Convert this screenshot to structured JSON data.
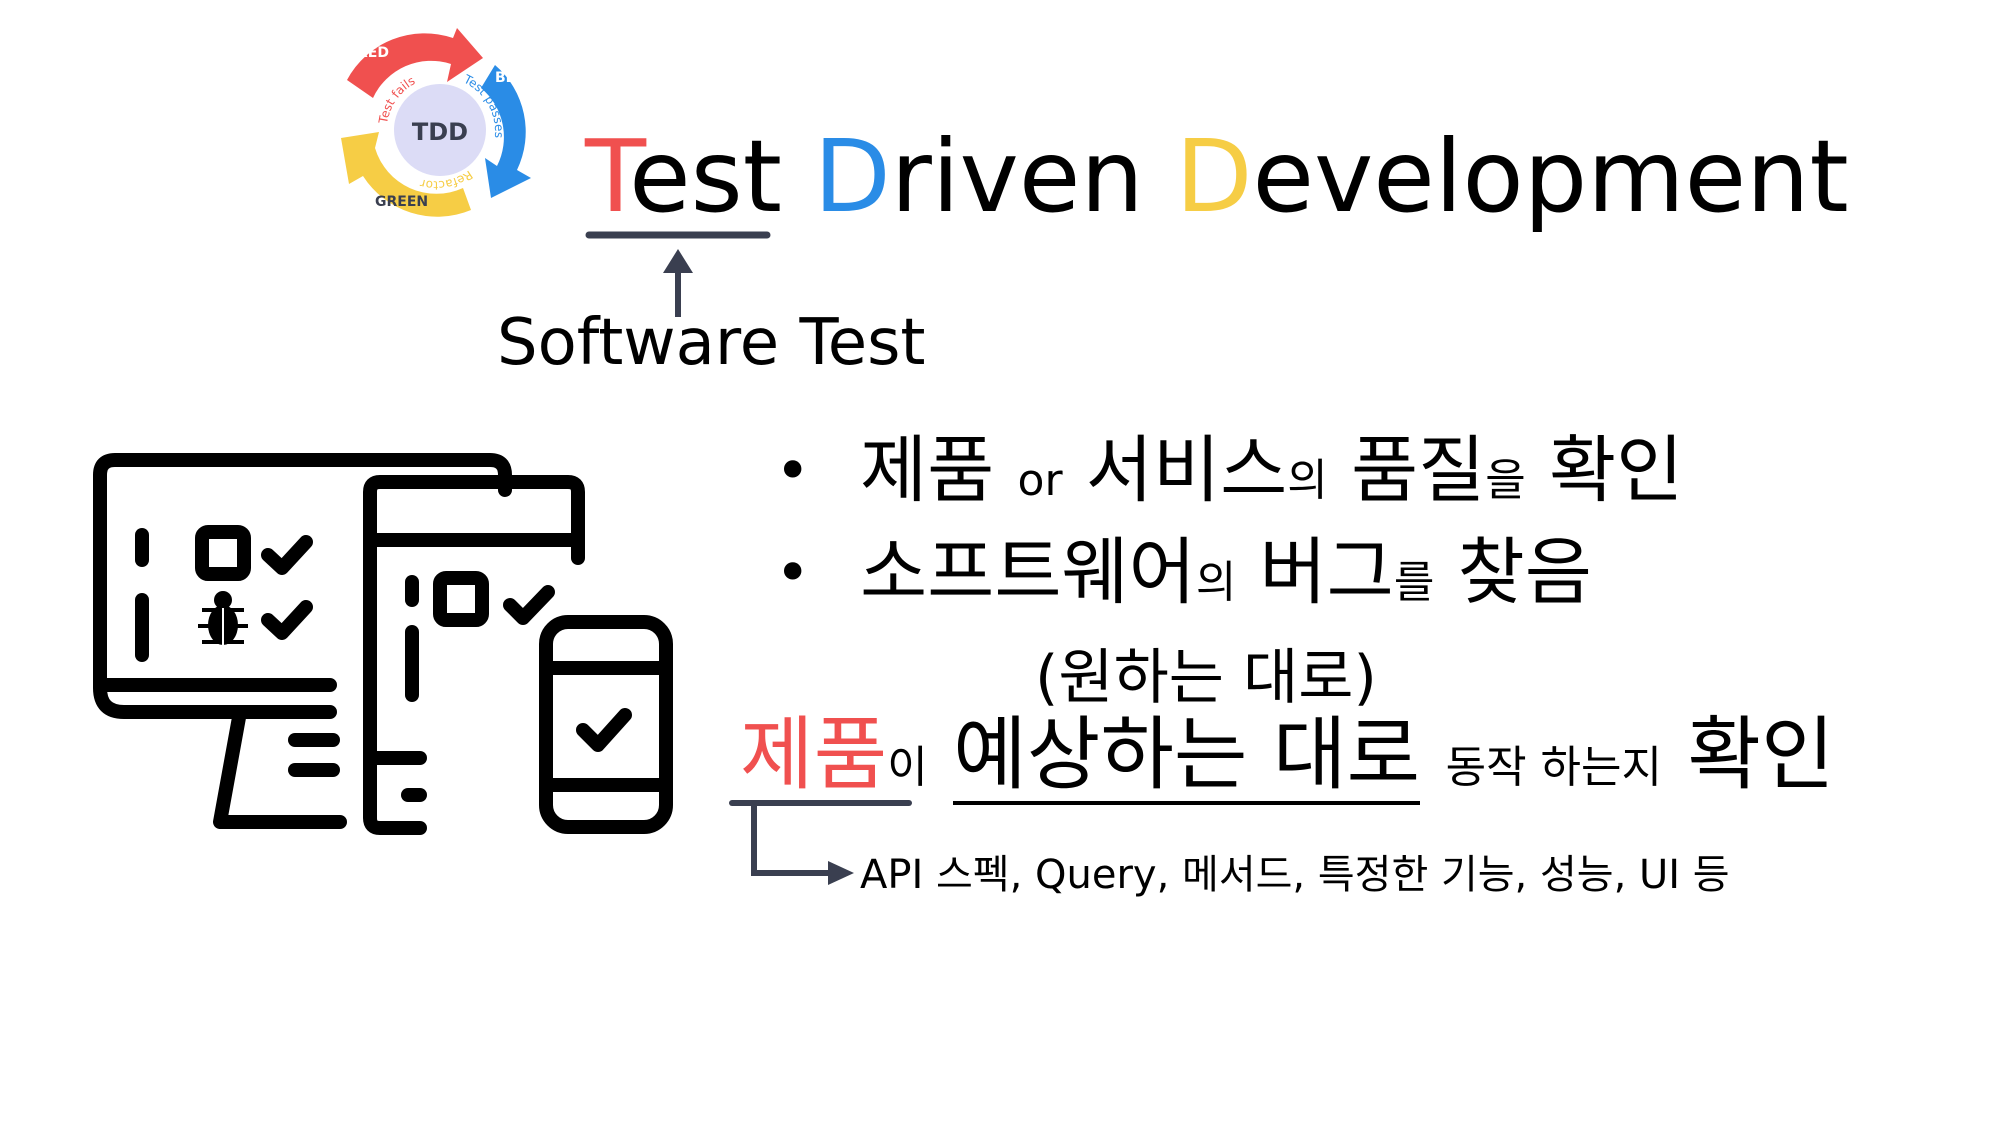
{
  "logo": {
    "center": "TDD",
    "red_label": "RED",
    "blue_label": "BLUE",
    "green_label": "GREEN",
    "arc_red": "Test fails",
    "arc_blue": "Test passes",
    "arc_green": "Refactor",
    "colors": {
      "red": "#f0504f",
      "blue": "#2a8ce6",
      "yellow": "#f6cd45",
      "center": "#dcdcf6"
    }
  },
  "title": {
    "t1_initial": "T",
    "t1_rest": "est",
    "t2_initial": "D",
    "t2_rest": "riven",
    "t3_initial": "D",
    "t3_rest": "evelopment"
  },
  "software_test_label": "Software Test",
  "bullets": [
    {
      "dot": "•",
      "p1": "제품",
      "p2": "or",
      "p3": "서비스",
      "p4": "의",
      "p5": "품질",
      "p6": "을",
      "p7": "확인"
    },
    {
      "dot": "•",
      "p1": "소프트웨어",
      "p2": "의",
      "p3": "버그",
      "p4": "를",
      "p5": "찾음"
    }
  ],
  "wish_note": "(원하는 대로)",
  "main_line": {
    "product": "제품",
    "particle": "이",
    "expected": "예상하는 대로",
    "action": "동작 하는지",
    "check": "확인"
  },
  "detail_text": "API 스펙, Query, 메서드, 특정한 기능, 성능, UI 등",
  "icon": {
    "name": "multi-device-test-icon"
  }
}
